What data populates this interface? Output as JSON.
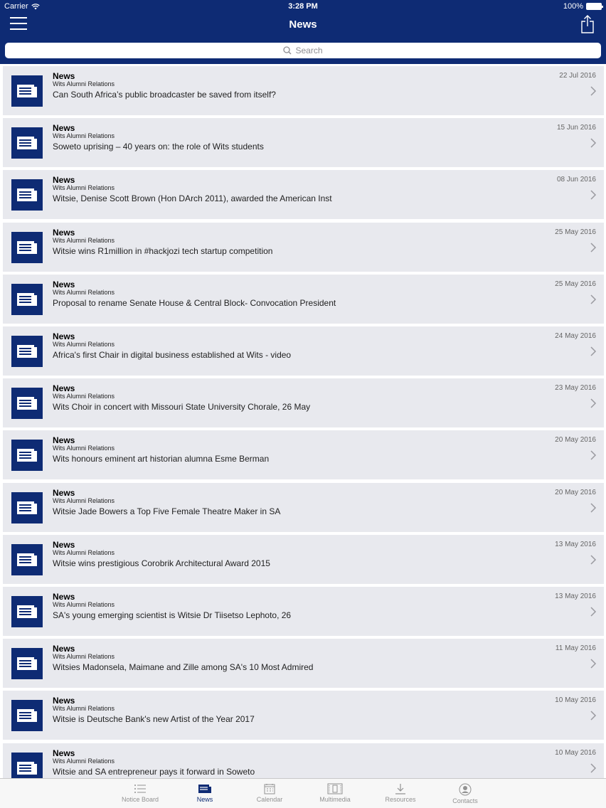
{
  "status_bar": {
    "carrier": "Carrier",
    "time": "3:28 PM",
    "battery": "100%"
  },
  "nav": {
    "title": "News",
    "menu_icon": "hamburger-menu-icon",
    "share_icon": "share-icon"
  },
  "search": {
    "placeholder": "Search"
  },
  "colors": {
    "brand": "#0e2b74",
    "row_background": "#e8e9ee"
  },
  "items": [
    {
      "type": "News",
      "source": "Wits Alumni Relations",
      "title": "Can South Africa’s public broadcaster be saved from itself?",
      "date": "22 Jul 2016"
    },
    {
      "type": "News",
      "source": "Wits Alumni Relations",
      "title": "Soweto uprising – 40 years on: the role of Wits students",
      "date": "15 Jun 2016"
    },
    {
      "type": "News",
      "source": "Wits Alumni Relations",
      "title": "Witsie, Denise Scott Brown (Hon DArch 2011), awarded the American Inst",
      "date": "08 Jun 2016"
    },
    {
      "type": "News",
      "source": "Wits Alumni Relations",
      "title": "Witsie wins R1million in #hackjozi tech startup competition",
      "date": "25 May 2016"
    },
    {
      "type": "News",
      "source": "Wits Alumni Relations",
      "title": "Proposal to rename Senate House & Central Block- Convocation President",
      "date": "25 May 2016"
    },
    {
      "type": "News",
      "source": "Wits Alumni Relations",
      "title": "Africa's first Chair in digital business established at Wits - video",
      "date": "24 May 2016"
    },
    {
      "type": "News",
      "source": "Wits Alumni Relations",
      "title": "Wits Choir in concert with Missouri State University Chorale, 26 May",
      "date": "23 May 2016"
    },
    {
      "type": "News",
      "source": "Wits Alumni Relations",
      "title": "Wits honours eminent art historian alumna Esme Berman",
      "date": "20 May 2016"
    },
    {
      "type": "News",
      "source": "Wits Alumni Relations",
      "title": "Witsie Jade Bowers a Top Five Female Theatre Maker in SA",
      "date": "20 May 2016"
    },
    {
      "type": "News",
      "source": "Wits Alumni Relations",
      "title": "Witsie wins prestigious Corobrik Architectural Award 2015",
      "date": "13 May 2016"
    },
    {
      "type": "News",
      "source": "Wits Alumni Relations",
      "title": "SA's young emerging scientist is Witsie Dr Tiisetso Lephoto, 26",
      "date": "13 May 2016"
    },
    {
      "type": "News",
      "source": "Wits Alumni Relations",
      "title": "Witsies Madonsela, Maimane and Zille among SA's 10 Most Admired",
      "date": "11 May 2016"
    },
    {
      "type": "News",
      "source": "Wits Alumni Relations",
      "title": "Witsie is Deutsche Bank's new Artist of the Year 2017",
      "date": "10 May 2016"
    },
    {
      "type": "News",
      "source": "Wits Alumni Relations",
      "title": "Witsie and SA entrepreneur pays it forward in Soweto",
      "date": "10 May 2016"
    }
  ],
  "tabs": [
    {
      "label": "Notice Board",
      "icon": "list-icon",
      "active": false
    },
    {
      "label": "News",
      "icon": "newspaper-icon",
      "active": true
    },
    {
      "label": "Calendar",
      "icon": "calendar-icon",
      "active": false
    },
    {
      "label": "Multimedia",
      "icon": "multimedia-icon",
      "active": false
    },
    {
      "label": "Resources",
      "icon": "download-icon",
      "active": false
    },
    {
      "label": "Contacts",
      "icon": "contact-icon",
      "active": false
    }
  ]
}
